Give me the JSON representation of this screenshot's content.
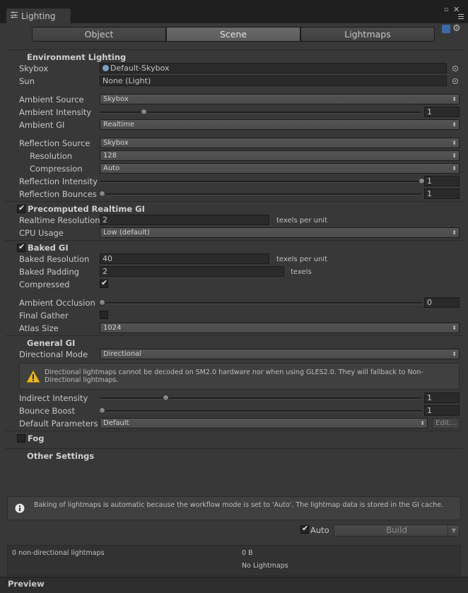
{
  "window": {
    "tab_title": "Lighting",
    "tab_icon": "lighting-list-icon"
  },
  "tabs": [
    {
      "label": "Object",
      "active": false
    },
    {
      "label": "Scene",
      "active": true
    },
    {
      "label": "Lightmaps",
      "active": false
    }
  ],
  "environment": {
    "header": "Environment Lighting",
    "skybox_label": "Skybox",
    "skybox_value": "Default-Skybox",
    "sun_label": "Sun",
    "sun_value": "None (Light)",
    "ambient_source_label": "Ambient Source",
    "ambient_source_value": "Skybox",
    "ambient_intensity_label": "Ambient Intensity",
    "ambient_intensity_value": "1",
    "ambient_intensity_level": 0.13,
    "ambient_gi_label": "Ambient GI",
    "ambient_gi_value": "Realtime",
    "reflection_source_label": "Reflection Source",
    "reflection_source_value": "Skybox",
    "resolution_label": "Resolution",
    "resolution_value": "128",
    "compression_label": "Compression",
    "compression_value": "Auto",
    "reflection_intensity_label": "Reflection Intensity",
    "reflection_intensity_value": "1",
    "reflection_intensity_level": 1.0,
    "reflection_bounces_label": "Reflection Bounces",
    "reflection_bounces_value": "1",
    "reflection_bounces_level": 0.0
  },
  "realtime_gi": {
    "header": "Precomputed Realtime GI",
    "enabled": true,
    "resolution_label": "Realtime Resolution",
    "resolution_value": "2",
    "resolution_unit": "texels per unit",
    "cpu_label": "CPU Usage",
    "cpu_value": "Low (default)"
  },
  "baked_gi": {
    "header": "Baked GI",
    "enabled": true,
    "resolution_label": "Baked Resolution",
    "resolution_value": "40",
    "resolution_unit": "texels per unit",
    "padding_label": "Baked Padding",
    "padding_value": "2",
    "padding_unit": "texels",
    "compressed_label": "Compressed",
    "compressed": true,
    "ao_label": "Ambient Occlusion",
    "ao_value": "0",
    "ao_level": 0.0,
    "final_gather_label": "Final Gather",
    "final_gather": false,
    "atlas_label": "Atlas Size",
    "atlas_value": "1024"
  },
  "general_gi": {
    "header": "General GI",
    "directional_label": "Directional Mode",
    "directional_value": "Directional",
    "warning_text": "Directional lightmaps cannot be decoded on SM2.0 hardware nor when using GLES2.0. They will fallback to Non-Directional lightmaps.",
    "indirect_label": "Indirect Intensity",
    "indirect_value": "1",
    "indirect_level": 0.2,
    "bounce_label": "Bounce Boost",
    "bounce_value": "1",
    "bounce_level": 0.0,
    "params_label": "Default Parameters",
    "params_value": "Default",
    "edit_label": "Edit..."
  },
  "fog": {
    "label": "Fog",
    "enabled": false
  },
  "other": {
    "header": "Other Settings"
  },
  "baking": {
    "info_text": "Baking of lightmaps is automatic because the workflow mode is set to 'Auto'. The lightmap data is stored in the GI cache.",
    "auto_label": "Auto",
    "auto": true,
    "build_label": "Build",
    "stats_left": "0 non-directional lightmaps",
    "stats_size": "0 B",
    "stats_status": "No Lightmaps"
  },
  "preview": {
    "label": "Preview"
  }
}
